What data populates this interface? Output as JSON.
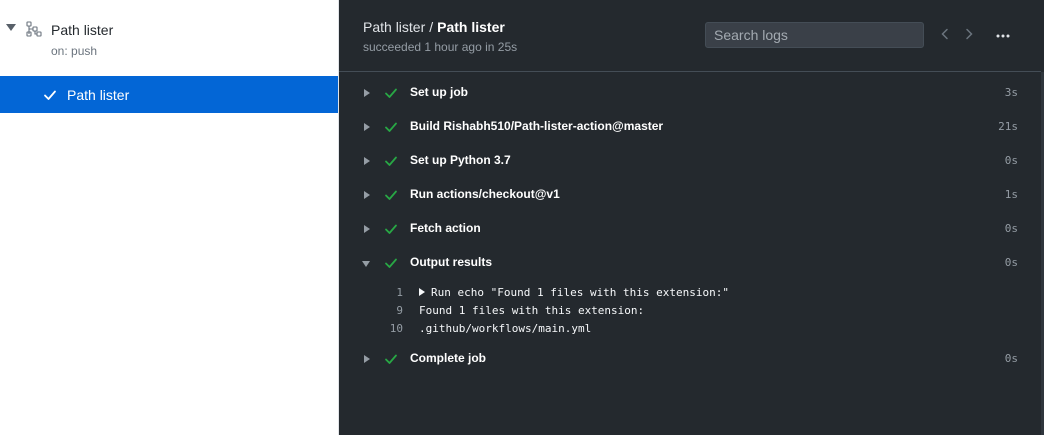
{
  "sidebar": {
    "workflow_name": "Path lister",
    "trigger": "on: push",
    "icon": "workflow-icon",
    "jobs": [
      {
        "label": "Path lister",
        "status": "success",
        "icon": "check-icon"
      }
    ]
  },
  "header": {
    "breadcrumb_parent": "Path lister",
    "breadcrumb_separator": "/",
    "breadcrumb_current": "Path lister",
    "run_status": "succeeded 1 hour ago in 25s",
    "search_placeholder": "Search logs",
    "prev_icon": "chevron-left-icon",
    "next_icon": "chevron-right-icon",
    "more_icon": "kebab-horizontal-icon"
  },
  "steps": [
    {
      "name": "Set up job",
      "duration": "3s",
      "expanded": false
    },
    {
      "name": "Build Rishabh510/Path-lister-action@master",
      "duration": "21s",
      "expanded": false
    },
    {
      "name": "Set up Python 3.7",
      "duration": "0s",
      "expanded": false
    },
    {
      "name": "Run actions/checkout@v1",
      "duration": "1s",
      "expanded": false
    },
    {
      "name": "Fetch action",
      "duration": "0s",
      "expanded": false
    },
    {
      "name": "Output results",
      "duration": "0s",
      "expanded": true
    },
    {
      "name": "Complete job",
      "duration": "0s",
      "expanded": false
    }
  ],
  "log_lines": [
    {
      "num": "1",
      "text": "Run echo \"Found 1 files with this extension:\"",
      "collapsible": true
    },
    {
      "num": "9",
      "text": "Found 1 files with this extension:",
      "collapsible": false
    },
    {
      "num": "10",
      "text": ".github/workflows/main.yml",
      "collapsible": false
    }
  ],
  "colors": {
    "accent": "#0366d6",
    "success": "#28a745",
    "panel_bg": "#24292e",
    "sidebar_bg": "#ffffff"
  }
}
